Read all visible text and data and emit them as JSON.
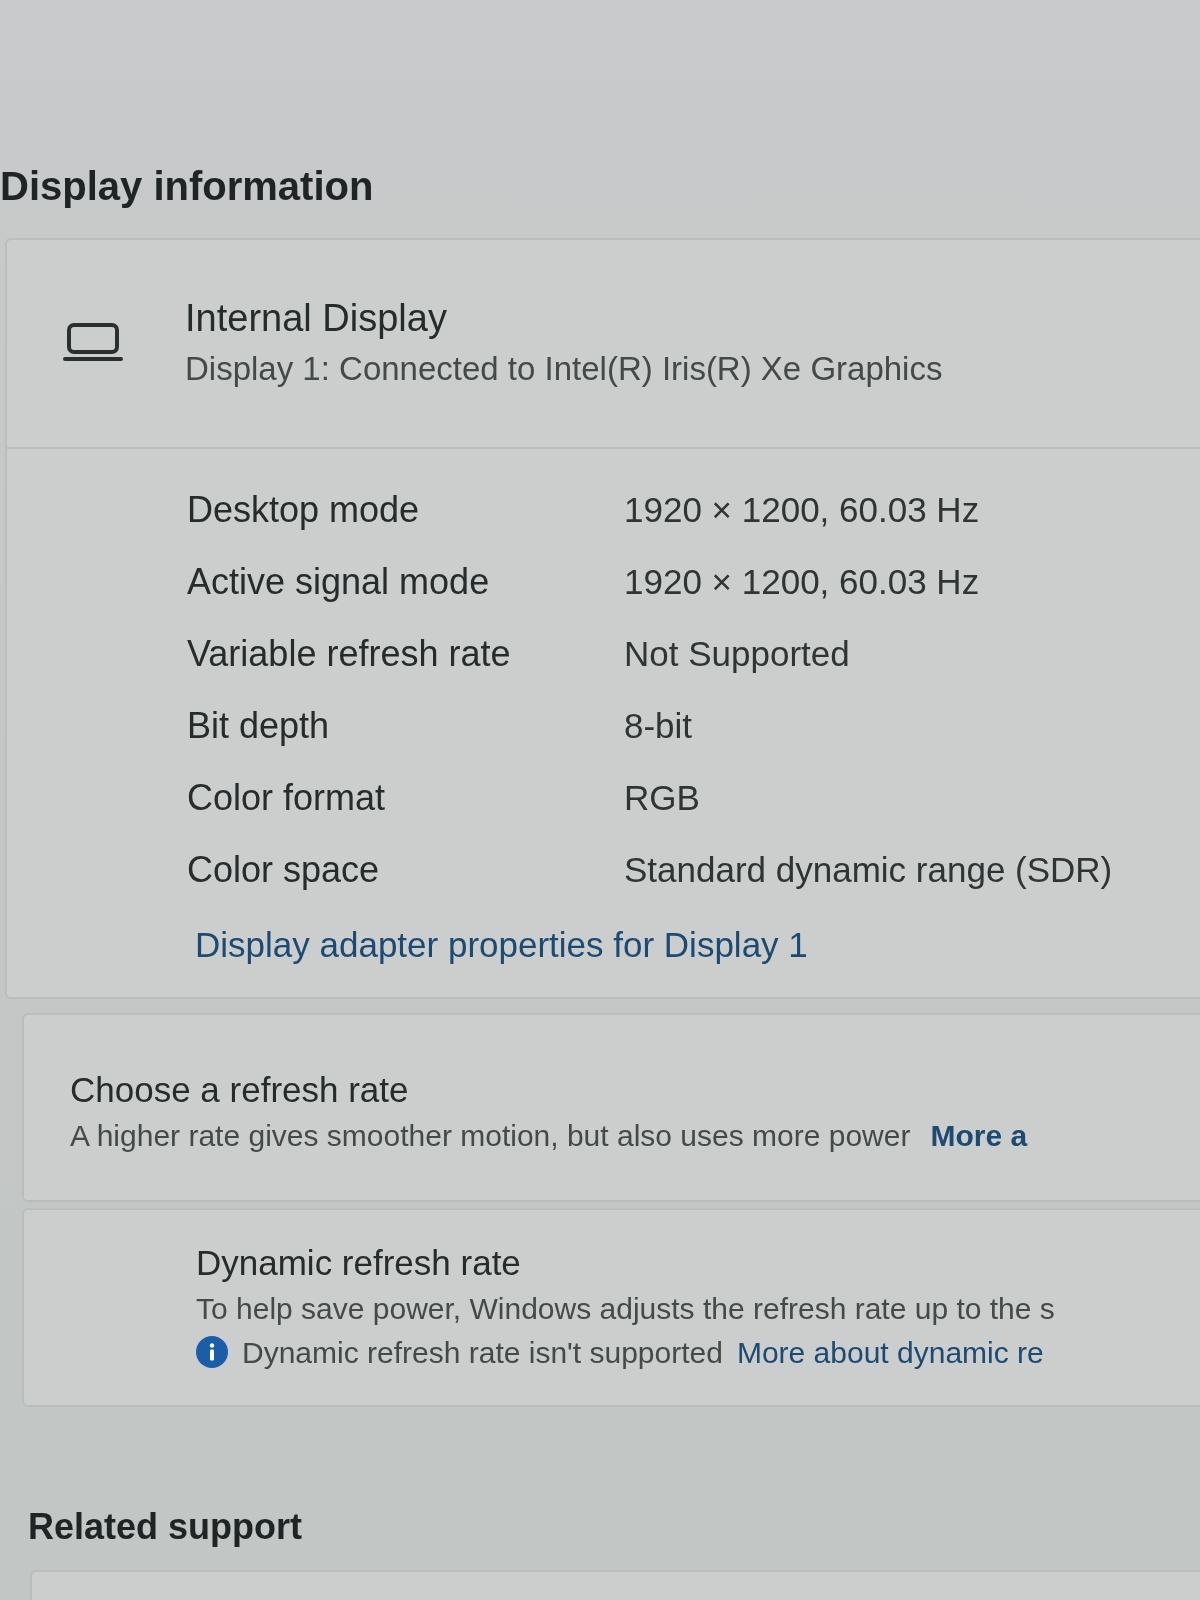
{
  "section_title": "Display information",
  "display_card": {
    "title": "Internal Display",
    "subtitle": "Display 1: Connected to Intel(R) Iris(R) Xe Graphics",
    "properties": [
      {
        "label": "Desktop mode",
        "value": "1920 × 1200, 60.03 Hz"
      },
      {
        "label": "Active signal mode",
        "value": "1920 × 1200, 60.03 Hz"
      },
      {
        "label": "Variable refresh rate",
        "value": "Not Supported"
      },
      {
        "label": "Bit depth",
        "value": "8-bit"
      },
      {
        "label": "Color format",
        "value": "RGB"
      },
      {
        "label": "Color space",
        "value": "Standard dynamic range (SDR)"
      }
    ],
    "link": "Display adapter properties for Display 1"
  },
  "refresh_rate_card": {
    "title": "Choose a refresh rate",
    "description": "A higher rate gives smoother motion, but also uses more power",
    "link": "More a"
  },
  "dynamic_refresh_card": {
    "title": "Dynamic refresh rate",
    "description": "To help save power, Windows adjusts the refresh rate up to the s",
    "notice": "Dynamic refresh rate isn't supported",
    "link": "More about dynamic re"
  },
  "related_support": {
    "title": "Related support"
  }
}
